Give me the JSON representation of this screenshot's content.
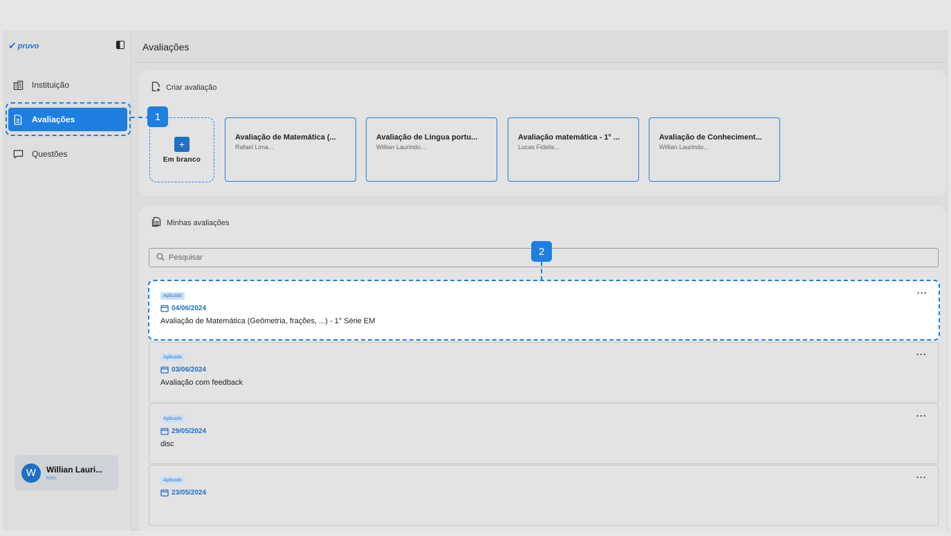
{
  "app": {
    "logo_text": "pruvo",
    "page_title": "Avaliações"
  },
  "sidebar": {
    "items": [
      {
        "label": "Instituição",
        "icon": "building-icon"
      },
      {
        "label": "Avaliações",
        "icon": "document-icon",
        "active": true
      },
      {
        "label": "Questões",
        "icon": "chat-icon"
      }
    ],
    "user": {
      "initial": "W",
      "name": "Willian Lauri...",
      "sub": "Mais"
    }
  },
  "create": {
    "header": "Criar avaliação",
    "blank_label": "Em branco",
    "templates": [
      {
        "title": "Avaliação de Matemática (...",
        "author": "Rafael Lima..."
      },
      {
        "title": "Avaliação de Lingua portu...",
        "author": "Willian Laurindo..."
      },
      {
        "title": "Avaliação matemática - 1° ...",
        "author": "Lucas Fidelis..."
      },
      {
        "title": "Avaliação de Conheciment...",
        "author": "Willian Laurindo..."
      }
    ]
  },
  "mine": {
    "header": "Minhas avaliações",
    "search_placeholder": "Pesquisar",
    "rows": [
      {
        "status": "Aplicado",
        "date": "04/06/2024",
        "title": "Avaliação de Matemática (Geômetria, frações, ...) - 1° Série EM"
      },
      {
        "status": "Aplicado",
        "date": "03/06/2024",
        "title": "Avaliação com feedback"
      },
      {
        "status": "Aplicado",
        "date": "29/05/2024",
        "title": "disc"
      },
      {
        "status": "Aplicado",
        "date": "23/05/2024",
        "title": ""
      }
    ]
  },
  "annotations": {
    "marker1": "1",
    "marker2": "2"
  },
  "colors": {
    "accent": "#1f7fe0",
    "brand": "#1f6fc4"
  }
}
